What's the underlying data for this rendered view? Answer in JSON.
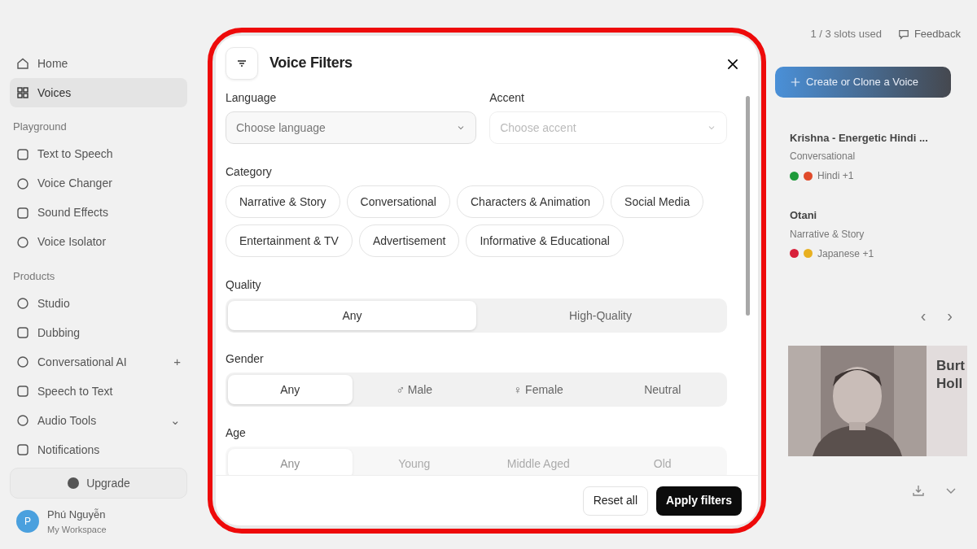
{
  "sidebar": {
    "items": [
      {
        "kind": "item",
        "label": "Home",
        "selected": false
      },
      {
        "kind": "item",
        "label": "Voices",
        "selected": true
      },
      {
        "kind": "section",
        "label": "Playground"
      },
      {
        "kind": "item",
        "label": "Text to Speech",
        "selected": false
      },
      {
        "kind": "item",
        "label": "Voice Changer",
        "selected": false
      },
      {
        "kind": "item",
        "label": "Sound Effects",
        "selected": false
      },
      {
        "kind": "item",
        "label": "Voice Isolator",
        "selected": false
      },
      {
        "kind": "section",
        "label": "Products"
      },
      {
        "kind": "item",
        "label": "Studio",
        "selected": false
      },
      {
        "kind": "item",
        "label": "Dubbing",
        "selected": false
      },
      {
        "kind": "item",
        "label": "Conversational AI",
        "selected": false,
        "trail": "+"
      },
      {
        "kind": "item",
        "label": "Speech to Text",
        "selected": false
      },
      {
        "kind": "item",
        "label": "Audio Tools",
        "selected": false,
        "trail": "⌄"
      },
      {
        "kind": "item",
        "label": "Notifications",
        "selected": false
      }
    ],
    "upgrade": "Upgrade",
    "user": {
      "name": "Phú Nguyễn",
      "workspace": "My Workspace",
      "initial": "P"
    }
  },
  "dialog": {
    "title": "Voice Filters",
    "language": {
      "label": "Language",
      "placeholder": "Choose language",
      "disabled": false
    },
    "accent": {
      "label": "Accent",
      "placeholder": "Choose accent",
      "disabled": true
    },
    "category": {
      "label": "Category",
      "chips": [
        {
          "label": "Narrative & Story",
          "selected": false
        },
        {
          "label": "Conversational",
          "selected": false
        },
        {
          "label": "Characters & Animation",
          "selected": false
        },
        {
          "label": "Social Media",
          "selected": false
        },
        {
          "label": "Entertainment & TV",
          "selected": false
        },
        {
          "label": "Advertisement",
          "selected": false
        },
        {
          "label": "Informative & Educational",
          "selected": false
        }
      ]
    },
    "segments": [
      {
        "label": "Quality",
        "options": [
          {
            "label": "Any",
            "selected": true
          },
          {
            "label": "High-Quality",
            "selected": false
          }
        ]
      },
      {
        "label": "Gender",
        "options": [
          {
            "label": "Any",
            "selected": true
          },
          {
            "label": "♂ Male",
            "selected": false
          },
          {
            "label": "♀ Female",
            "selected": false
          },
          {
            "label": "Neutral",
            "selected": false
          }
        ]
      },
      {
        "label": "Age",
        "options": [
          {
            "label": "Any",
            "selected": true
          },
          {
            "label": "Young",
            "selected": false
          },
          {
            "label": "Middle Aged",
            "selected": false
          },
          {
            "label": "Old",
            "selected": false
          }
        ]
      }
    ],
    "buttons": [
      {
        "kind": "secondary",
        "label": "Reset all"
      },
      {
        "kind": "primary",
        "label": "Apply filters"
      }
    ]
  },
  "right_panel": {
    "slots": "1 / 3 slots used",
    "feedback": "Feedback",
    "create_button": "Create or Clone a Voice",
    "voices": [
      {
        "name": "Krishna - Energetic Hindi ...",
        "category": "Conversational",
        "language": "Hindi +1",
        "flags": [
          {
            "color": "#1e9a3a"
          },
          {
            "color": "#e04a2a"
          }
        ]
      },
      {
        "name": "Otani",
        "category": "Narrative & Story",
        "language": "Japanese +1",
        "flags": [
          {
            "color": "#d8203a"
          },
          {
            "color": "#e8b020"
          }
        ]
      }
    ],
    "prev": "‹",
    "next": "›",
    "card": {
      "kind": "picture",
      "title_lines": [
        "Burt",
        "Holl"
      ]
    }
  }
}
